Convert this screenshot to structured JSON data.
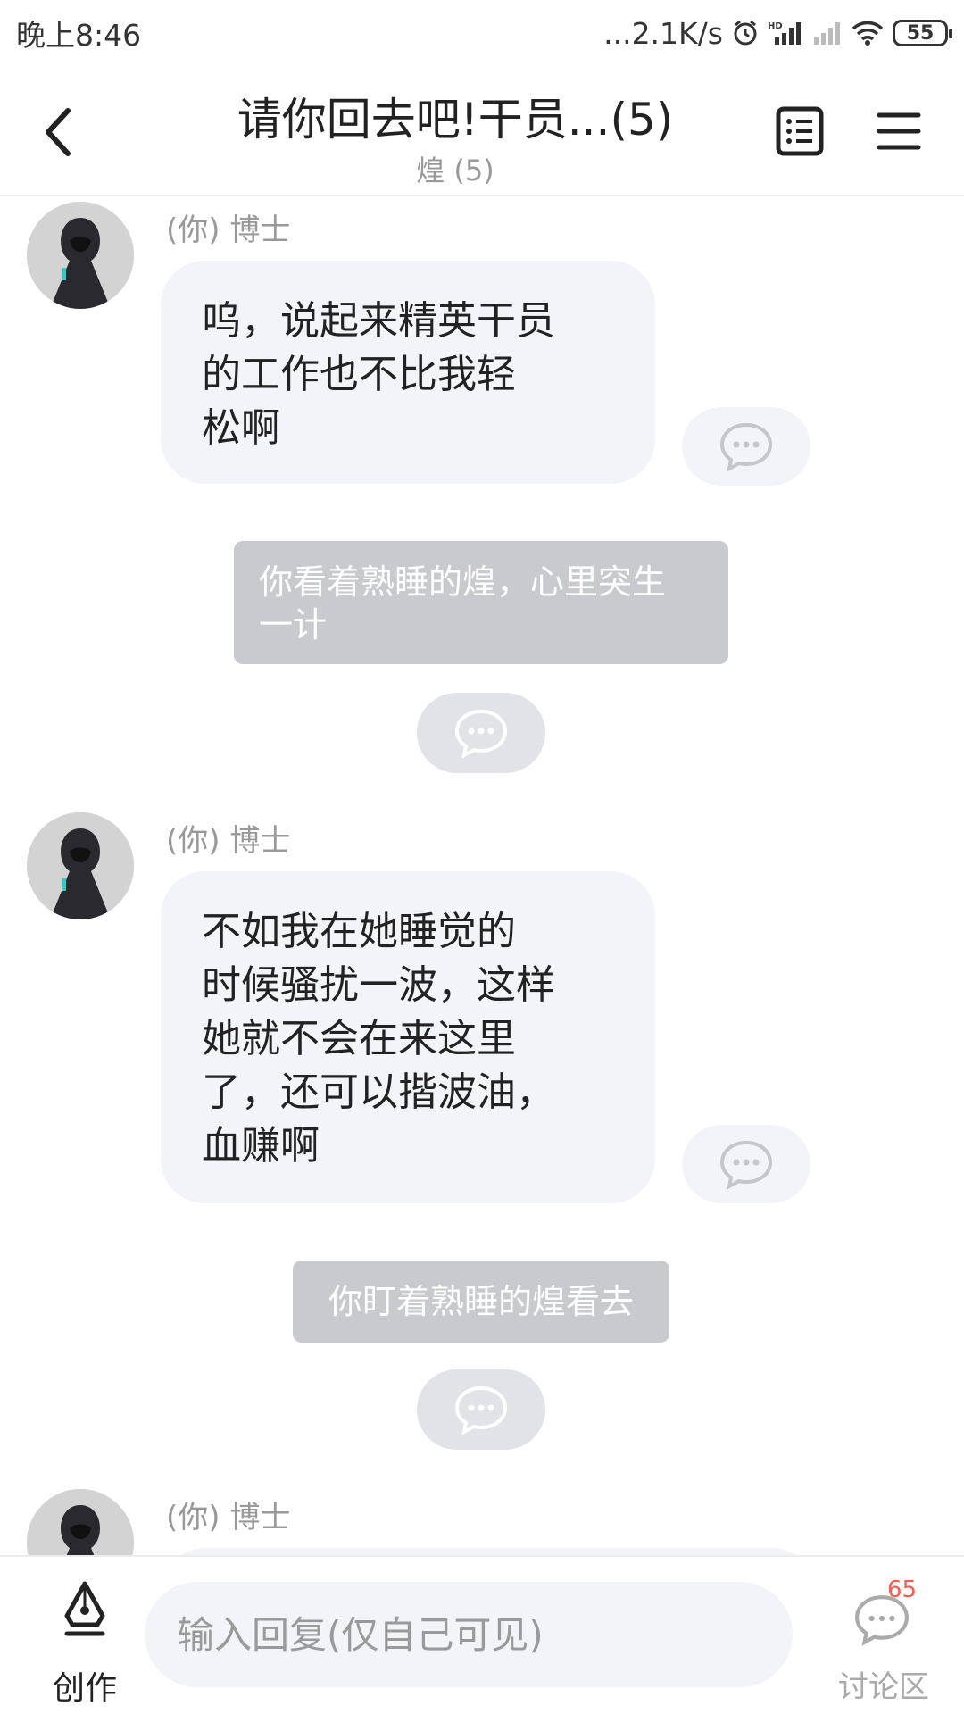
{
  "status_bar": {
    "time": "晚上8:46",
    "network_speed": "...2.1K/s",
    "battery_level": "55",
    "icons": [
      "alarm-icon",
      "hd-signal-icon",
      "signal-weak-icon",
      "wifi-icon",
      "battery-icon"
    ]
  },
  "header": {
    "title": "请你回去吧!干员...(5)",
    "subtitle": "煌 (5)",
    "icons": [
      "back-arrow-icon",
      "list-icon",
      "menu-icon"
    ]
  },
  "messages": [
    {
      "sender": "(你) 博士",
      "text": "呜，说起来精英干员\n的工作也不比我轻\n松啊"
    },
    {
      "narration": "你看着熟睡的煌，心里突生\n一计"
    },
    {
      "sender": "(你) 博士",
      "text": "不如我在她睡觉的\n时候骚扰一波，这样\n她就不会在来这里\n了，还可以揩波油，\n血赚啊"
    },
    {
      "narration": "你盯着熟睡的煌看去"
    },
    {
      "sender": "(你) 博士",
      "text": ""
    }
  ],
  "bottom_bar": {
    "create_label": "创作",
    "reply_placeholder": "输入回复(仅自己可见)",
    "discuss_label": "讨论区",
    "discuss_count": "65"
  },
  "colors": {
    "bubble_bg": "#f3f4f7",
    "narration_bg": "#c9cacd",
    "badge": "#ff5a4e",
    "muted_text": "#999999"
  }
}
